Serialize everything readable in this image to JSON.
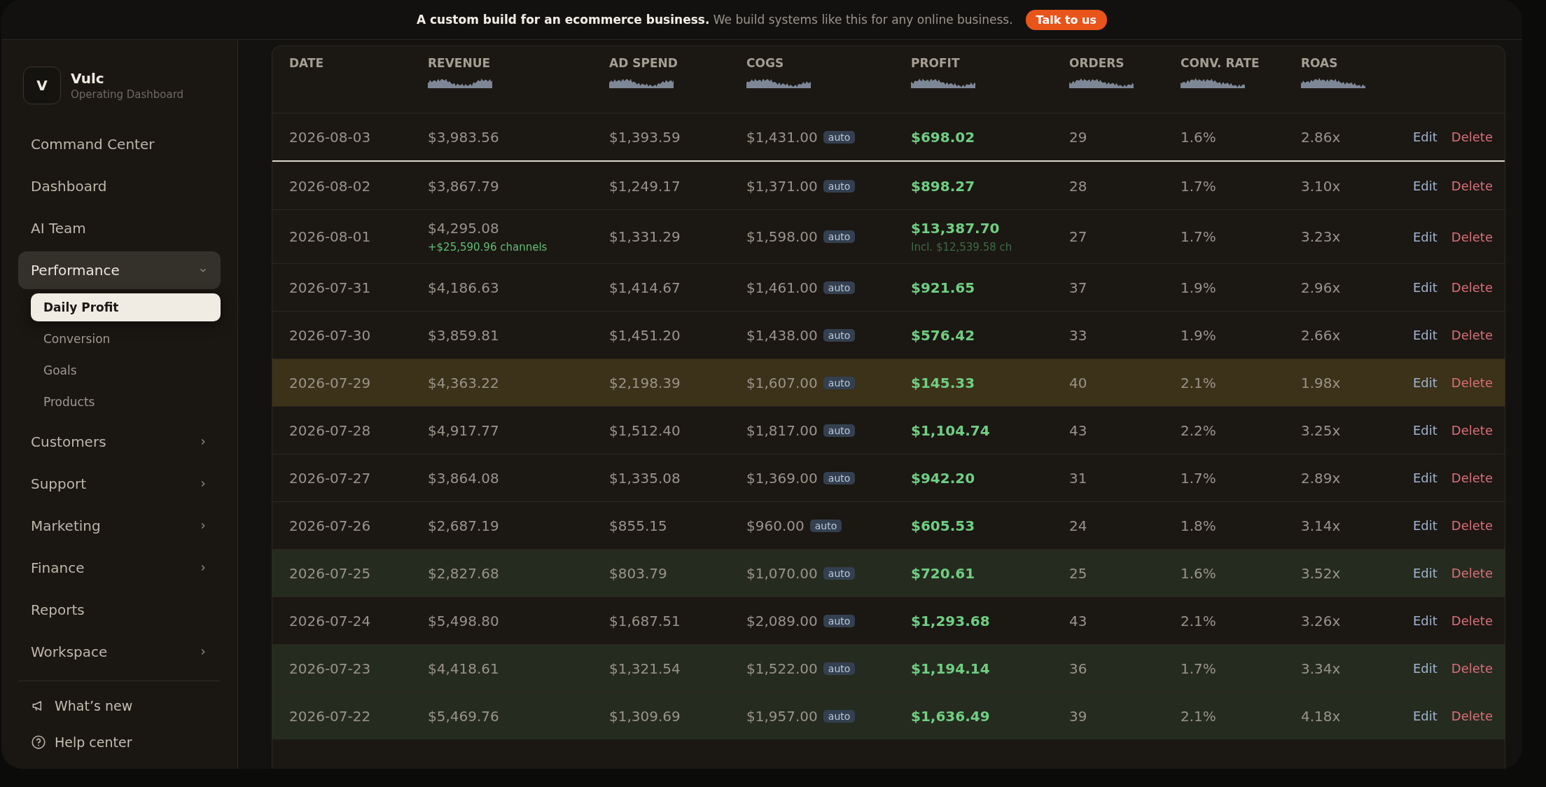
{
  "banner": {
    "lead": "A custom build for an ecommerce business.",
    "text": "We build systems like this for any online business.",
    "button": "Talk to us"
  },
  "sidebar": {
    "logo_letter": "V",
    "brand": "Vulc",
    "subtitle": "Operating Dashboard",
    "items": [
      {
        "label": "Command Center",
        "selected": false
      },
      {
        "label": "Dashboard",
        "selected": false
      },
      {
        "label": "AI Team",
        "selected": false
      },
      {
        "label": "Performance",
        "selected": true,
        "expanded": true,
        "children": [
          {
            "label": "Daily Profit",
            "selected": true
          },
          {
            "label": "Conversion",
            "selected": false
          },
          {
            "label": "Goals",
            "selected": false
          },
          {
            "label": "Products",
            "selected": false
          }
        ]
      },
      {
        "label": "Customers",
        "selected": false,
        "expanded": false
      },
      {
        "label": "Support",
        "selected": false,
        "expanded": false
      },
      {
        "label": "Marketing",
        "selected": false,
        "expanded": false
      },
      {
        "label": "Finance",
        "selected": false,
        "expanded": false
      },
      {
        "label": "Reports",
        "selected": false
      },
      {
        "label": "Workspace",
        "selected": false,
        "expanded": false
      }
    ],
    "footer": [
      {
        "kind": "news",
        "label": "What’s new"
      },
      {
        "kind": "help",
        "label": "Help center"
      }
    ]
  },
  "table": {
    "columns": [
      {
        "label": "DATE",
        "kind": "date"
      },
      {
        "label": "REVENUE",
        "kind": "metric"
      },
      {
        "label": "AD SPEND",
        "kind": "metric"
      },
      {
        "label": "COGS",
        "kind": "metric"
      },
      {
        "label": "PROFIT",
        "kind": "metric"
      },
      {
        "label": "ORDERS",
        "kind": "metric"
      },
      {
        "label": "CONV. RATE",
        "kind": "metric"
      },
      {
        "label": "ROAS",
        "kind": "metric"
      }
    ],
    "rows": [
      {
        "date": "2026-08-03",
        "revenue": "$3,983.56",
        "ad_spend": "$1,393.59",
        "cogs": "$1,431.00",
        "cogs_tag": "auto",
        "profit": "$698.02",
        "orders": "29",
        "conv_rate": "1.6%",
        "roas": "2.86x",
        "edit": "Edit",
        "delete": "Delete",
        "selected": true
      },
      {
        "date": "2026-08-02",
        "revenue": "$3,867.79",
        "ad_spend": "$1,249.17",
        "cogs": "$1,371.00",
        "cogs_tag": "auto",
        "profit": "$898.27",
        "orders": "28",
        "conv_rate": "1.7%",
        "roas": "3.10x",
        "edit": "Edit",
        "delete": "Delete",
        "selected": false
      },
      {
        "date": "2026-08-01",
        "revenue": "$4,295.08",
        "revenue_note": "+$25,590.96 channels",
        "ad_spend": "$1,331.29",
        "cogs": "$1,598.00",
        "cogs_tag": "auto",
        "profit": "$13,387.70",
        "profit_note": "Incl. $12,539.58 ch",
        "orders": "27",
        "conv_rate": "1.7%",
        "roas": "3.23x",
        "edit": "Edit",
        "delete": "Delete",
        "selected": false
      },
      {
        "date": "2026-07-31",
        "revenue": "$4,186.63",
        "ad_spend": "$1,414.67",
        "cogs": "$1,461.00",
        "cogs_tag": "auto",
        "profit": "$921.65",
        "orders": "37",
        "conv_rate": "1.9%",
        "roas": "2.96x",
        "edit": "Edit",
        "delete": "Delete",
        "selected": false
      },
      {
        "date": "2026-07-30",
        "revenue": "$3,859.81",
        "ad_spend": "$1,451.20",
        "cogs": "$1,438.00",
        "cogs_tag": "auto",
        "profit": "$576.42",
        "orders": "33",
        "conv_rate": "1.9%",
        "roas": "2.66x",
        "edit": "Edit",
        "delete": "Delete",
        "selected": false
      },
      {
        "date": "2026-07-29",
        "revenue": "$4,363.22",
        "ad_spend": "$2,198.39",
        "cogs": "$1,607.00",
        "cogs_tag": "auto",
        "profit": "$145.33",
        "orders": "40",
        "conv_rate": "2.1%",
        "roas": "1.98x",
        "edit": "Edit",
        "delete": "Delete",
        "color": "#3c3119",
        "selected": false
      },
      {
        "date": "2026-07-28",
        "revenue": "$4,917.77",
        "ad_spend": "$1,512.40",
        "cogs": "$1,817.00",
        "cogs_tag": "auto",
        "profit": "$1,104.74",
        "orders": "43",
        "conv_rate": "2.2%",
        "roas": "3.25x",
        "edit": "Edit",
        "delete": "Delete",
        "selected": false
      },
      {
        "date": "2026-07-27",
        "revenue": "$3,864.08",
        "ad_spend": "$1,335.08",
        "cogs": "$1,369.00",
        "cogs_tag": "auto",
        "profit": "$942.20",
        "orders": "31",
        "conv_rate": "1.7%",
        "roas": "2.89x",
        "edit": "Edit",
        "delete": "Delete",
        "selected": false
      },
      {
        "date": "2026-07-26",
        "revenue": "$2,687.19",
        "ad_spend": "$855.15",
        "cogs": "$960.00",
        "cogs_tag": "auto",
        "profit": "$605.53",
        "orders": "24",
        "conv_rate": "1.8%",
        "roas": "3.14x",
        "edit": "Edit",
        "delete": "Delete",
        "selected": false
      },
      {
        "date": "2026-07-25",
        "revenue": "$2,827.68",
        "ad_spend": "$803.79",
        "cogs": "$1,070.00",
        "cogs_tag": "auto",
        "profit": "$720.61",
        "orders": "25",
        "conv_rate": "1.6%",
        "roas": "3.52x",
        "edit": "Edit",
        "delete": "Delete",
        "color": "#262b1f",
        "selected": false
      },
      {
        "date": "2026-07-24",
        "revenue": "$5,498.80",
        "ad_spend": "$1,687.51",
        "cogs": "$2,089.00",
        "cogs_tag": "auto",
        "profit": "$1,293.68",
        "orders": "43",
        "conv_rate": "2.1%",
        "roas": "3.26x",
        "edit": "Edit",
        "delete": "Delete",
        "selected": false
      },
      {
        "date": "2026-07-23",
        "revenue": "$4,418.61",
        "ad_spend": "$1,321.54",
        "cogs": "$1,522.00",
        "cogs_tag": "auto",
        "profit": "$1,194.14",
        "orders": "36",
        "conv_rate": "1.7%",
        "roas": "3.34x",
        "edit": "Edit",
        "delete": "Delete",
        "color": "#262b1f",
        "selected": false
      },
      {
        "date": "2026-07-22",
        "revenue": "$5,469.76",
        "ad_spend": "$1,309.69",
        "cogs": "$1,957.00",
        "cogs_tag": "auto",
        "profit": "$1,636.49",
        "orders": "39",
        "conv_rate": "2.1%",
        "roas": "4.18x",
        "edit": "Edit",
        "delete": "Delete",
        "color": "#262b1f",
        "selected": false
      }
    ]
  }
}
